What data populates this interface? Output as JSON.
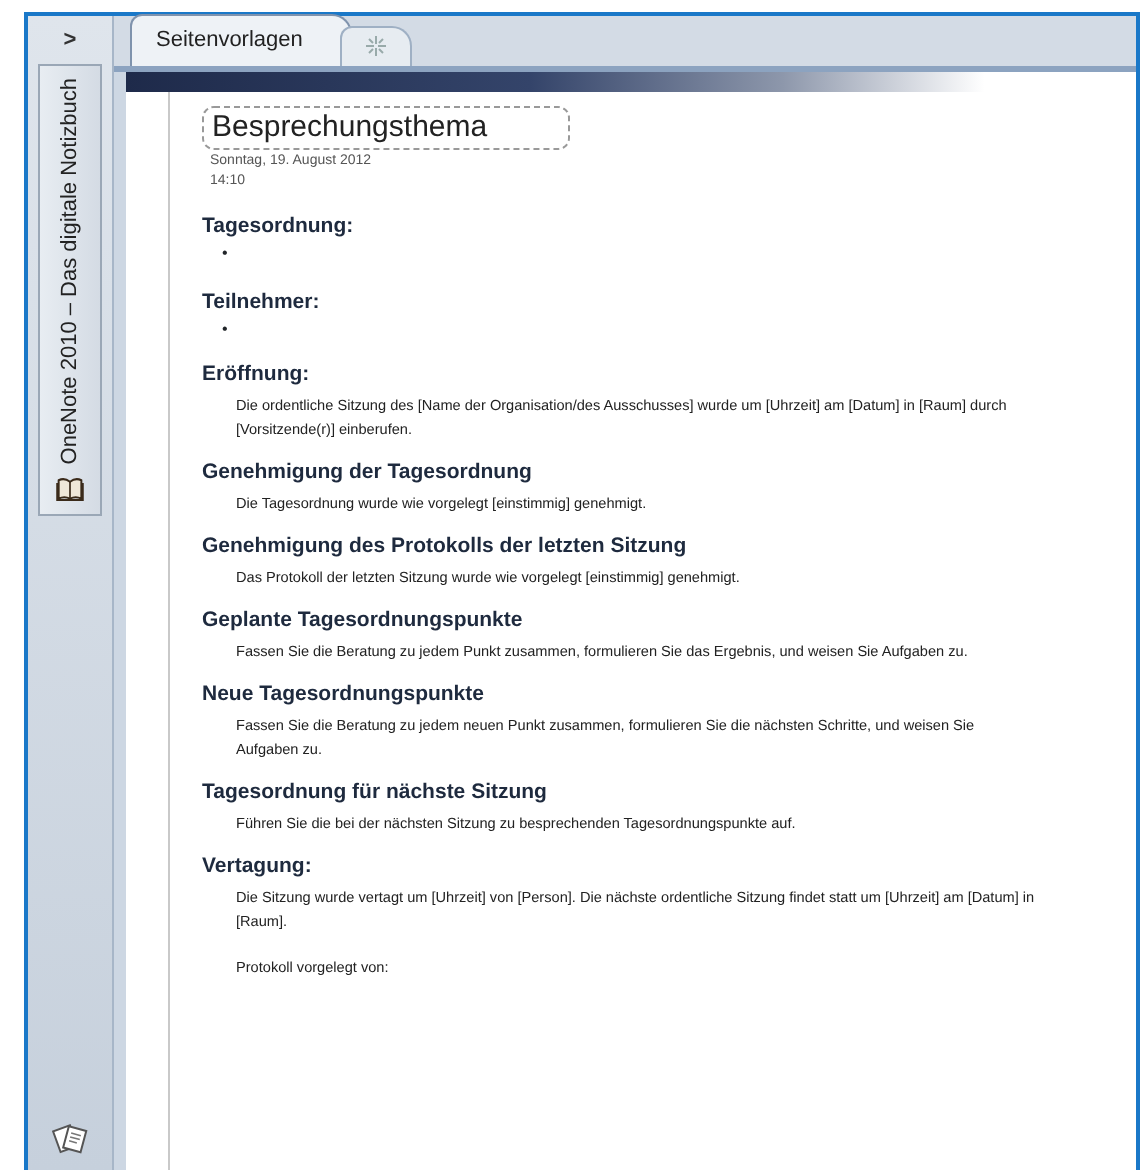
{
  "sidebar": {
    "expand_button": ">",
    "notebook": {
      "label": "OneNote 2010 – Das digitale Notizbuch"
    }
  },
  "tabs": [
    {
      "label": "Seitenvorlagen",
      "selected": true,
      "kind": "page"
    },
    {
      "kind": "new",
      "selected": false
    }
  ],
  "page": {
    "title": "Besprechungsthema",
    "date": "Sonntag, 19. August 2012",
    "time": "14:10",
    "sections": [
      {
        "kind": "bullet",
        "heading": "Tagesordnung:",
        "items": [
          "•"
        ]
      },
      {
        "kind": "bullet",
        "heading": "Teilnehmer:",
        "items": [
          "•"
        ]
      },
      {
        "kind": "text",
        "heading": "Eröffnung:",
        "paragraphs": [
          "Die ordentliche Sitzung des [Name der Organisation/des Ausschusses] wurde um [Uhrzeit] am [Datum] in [Raum] durch [Vorsitzende(r)] einberufen."
        ]
      },
      {
        "kind": "text",
        "heading": "Genehmigung der Tagesordnung",
        "paragraphs": [
          "Die Tagesordnung wurde wie vorgelegt [einstimmig] genehmigt."
        ]
      },
      {
        "kind": "text",
        "heading": "Genehmigung des Protokolls der letzten Sitzung",
        "paragraphs": [
          "Das Protokoll der letzten Sitzung wurde wie vorgelegt [einstimmig] genehmigt."
        ]
      },
      {
        "kind": "text",
        "heading": "Geplante Tagesordnungspunkte",
        "paragraphs": [
          "Fassen Sie die Beratung zu jedem Punkt zusammen, formulieren Sie das Ergebnis, und weisen Sie Aufgaben zu."
        ]
      },
      {
        "kind": "text",
        "heading": "Neue Tagesordnungspunkte",
        "paragraphs": [
          "Fassen Sie die Beratung zu jedem neuen Punkt zusammen, formulieren Sie die nächsten Schritte, und weisen Sie Aufgaben zu."
        ]
      },
      {
        "kind": "text",
        "heading": "Tagesordnung für nächste Sitzung",
        "paragraphs": [
          "Führen Sie die bei der nächsten Sitzung zu besprechenden Tagesordnungspunkte auf."
        ]
      },
      {
        "kind": "text",
        "heading": "Vertagung:",
        "paragraphs": [
          "Die Sitzung wurde vertagt um [Uhrzeit] von [Person]. Die nächste ordentliche Sitzung findet statt um [Uhrzeit] am [Datum] in [Raum].",
          "Protokoll vorgelegt von:"
        ]
      }
    ]
  }
}
